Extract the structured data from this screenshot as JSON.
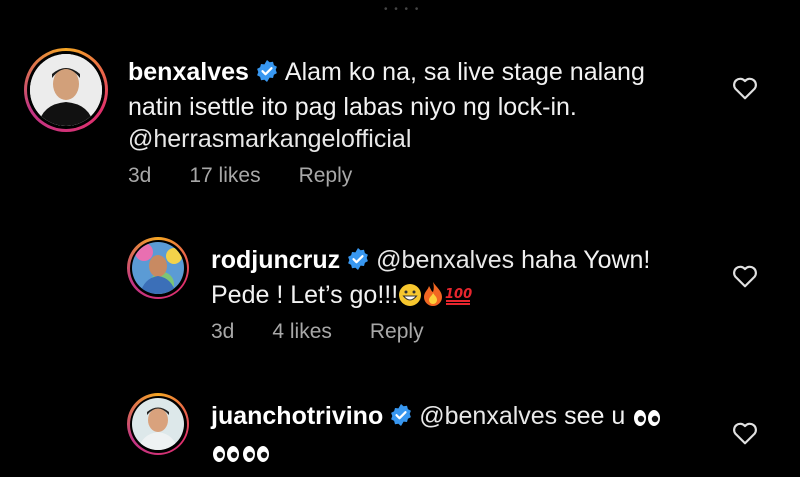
{
  "comments": [
    {
      "username": "benxalves",
      "text_line1": "Alam ko na, sa live stage nalang",
      "text_line2": "natin isettle ito pag labas niyo ng lock-in.",
      "text_line3": "@herrasmarkangelofficial",
      "time": "3d",
      "likes": "17 likes",
      "reply_label": "Reply"
    },
    {
      "username": "rodjuncruz",
      "mention": "@benxalves",
      "text_line1": "haha Yown!",
      "text_line2": "Pede ! Let’s go!!!",
      "time": "3d",
      "likes": "4 likes",
      "reply_label": "Reply",
      "emojis": [
        "grinning-face",
        "fire",
        "hundred-points"
      ]
    },
    {
      "username": "juanchotrivino",
      "mention": "@benxalves",
      "text_line1": "see u",
      "emojis": [
        "eyes",
        "eyes",
        "eyes"
      ]
    }
  ],
  "icons": {
    "verified": "verified-badge-icon",
    "like": "heart-outline-icon"
  },
  "colors": {
    "verified_blue": "#3897f0",
    "meta_gray": "#a8a8a8"
  }
}
